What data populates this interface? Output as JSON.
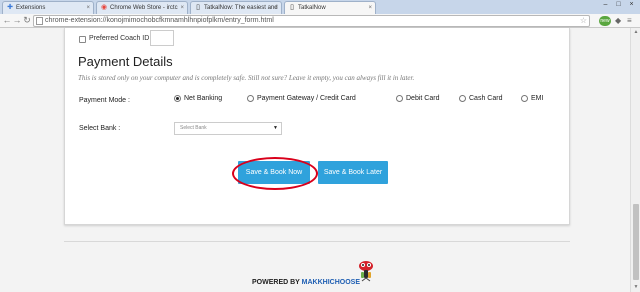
{
  "browser": {
    "tabs": [
      {
        "label": "Extensions",
        "icon": "puzzle-icon",
        "active": false
      },
      {
        "label": "Chrome Web Store - irctc",
        "icon": "webstore-icon",
        "active": false
      },
      {
        "label": "TatkalNow: The easiest and",
        "icon": "page-icon",
        "active": false
      },
      {
        "label": "TatkalNow",
        "icon": "page-icon",
        "active": true
      }
    ],
    "tab_close": "×",
    "window_controls": [
      "–",
      "□",
      "×"
    ],
    "address": "chrome-extension://konojmimochobcfkmnamhlhnpiofplkm/entry_form.html",
    "ext_badge": "new"
  },
  "form": {
    "preferred_coach_label": "Preferred Coach ID",
    "payment_title": "Payment Details",
    "payment_note": "This is stored only on your computer and is completely safe. Still not sure? Leave it empty, you can always fill it in later.",
    "payment_mode_label": "Payment Mode :",
    "payment_options": [
      {
        "label": "Net Banking",
        "selected": true
      },
      {
        "label": "Payment Gateway / Credit Card",
        "selected": false
      },
      {
        "label": "Debit Card",
        "selected": false
      },
      {
        "label": "Cash Card",
        "selected": false
      },
      {
        "label": "EMI",
        "selected": false
      }
    ],
    "select_bank_label": "Select Bank :",
    "select_bank_value": "Select Bank",
    "save_book_now": "Save & Book Now",
    "save_book_later": "Save & Book Later"
  },
  "footer": {
    "powered_by": "POWERED BY",
    "brand": "MAKKHICHOOSE"
  },
  "colors": {
    "button": "#2fa2dc",
    "highlight": "#d9001b",
    "brand": "#1f5fb3"
  }
}
